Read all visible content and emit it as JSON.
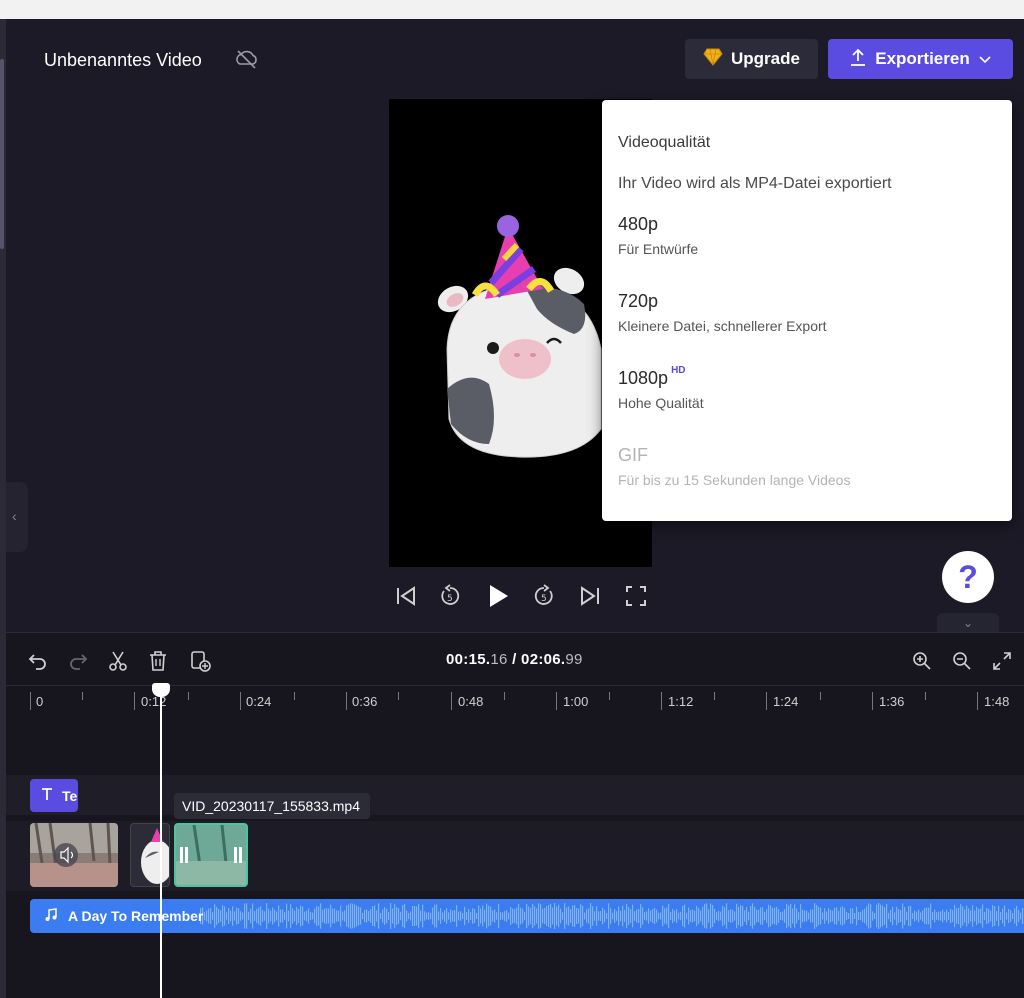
{
  "header": {
    "title": "Unbenanntes Video",
    "upgrade_label": "Upgrade",
    "export_label": "Exportieren"
  },
  "export_menu": {
    "heading": "Videoqualität",
    "subtitle": "Ihr Video wird als MP4-Datei exportiert",
    "options": [
      {
        "label": "480p",
        "description": "Für Entwürfe",
        "badge": ""
      },
      {
        "label": "720p",
        "description": "Kleinere Datei, schnellerer Export",
        "badge": ""
      },
      {
        "label": "1080p",
        "description": "Hohe Qualität",
        "badge": "HD"
      },
      {
        "label": "GIF",
        "description": "Für bis zu 15 Sekunden lange Videos",
        "badge": ""
      }
    ]
  },
  "help": {
    "label": "?"
  },
  "timeline": {
    "current_time": "00:15.",
    "current_frac": "16",
    "separator": " / ",
    "total_time": "02:06.",
    "total_frac": "99",
    "ruler_labels": [
      "0",
      "0:12",
      "0:24",
      "0:36",
      "0:48",
      "1:00",
      "1:12",
      "1:24",
      "1:36",
      "1:48"
    ],
    "text_clip_label": "Te",
    "video_tooltip": "VID_20230117_155833.mp4",
    "audio_clip_label": "A Day To Remember"
  },
  "colors": {
    "accent": "#5a4ce0",
    "audio_track": "#3b7cf0",
    "background": "#1b1a26"
  }
}
